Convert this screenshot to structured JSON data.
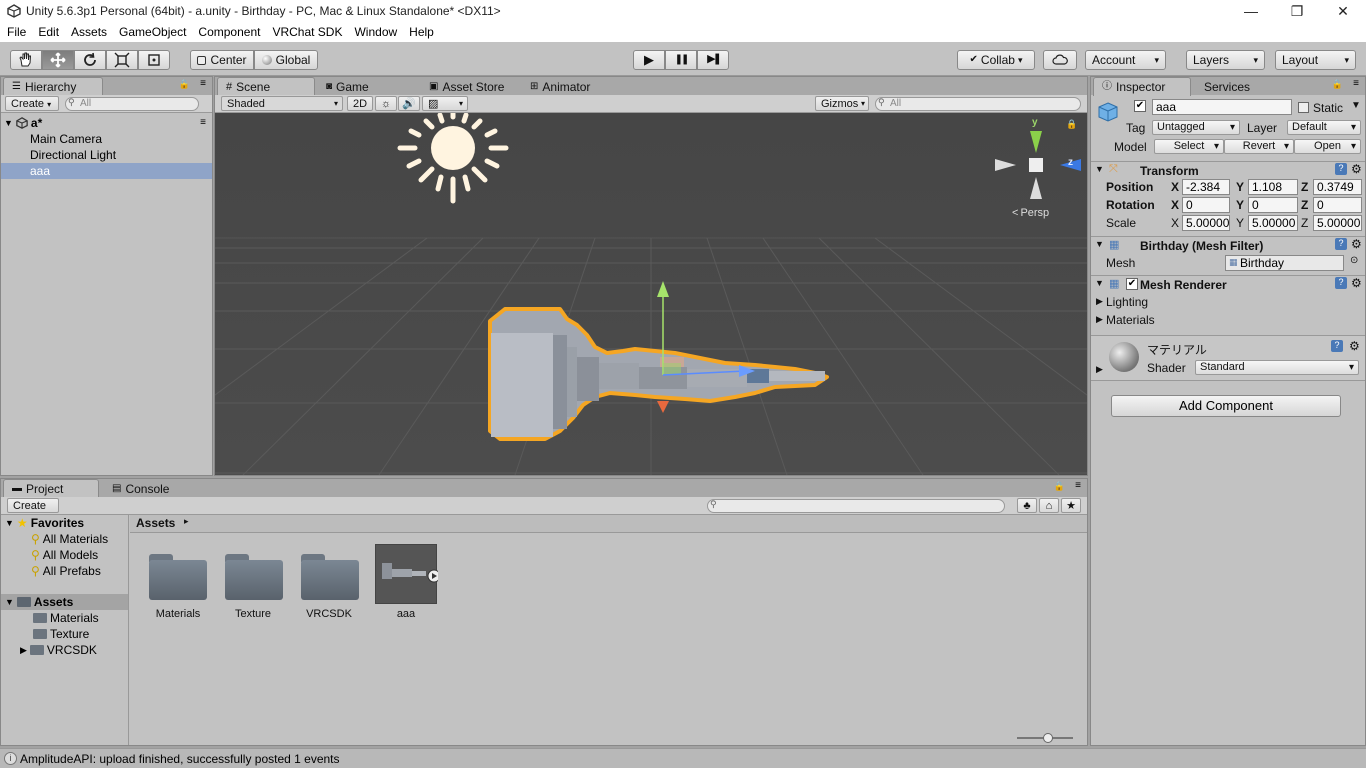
{
  "window": {
    "title": "Unity 5.6.3p1 Personal (64bit) - a.unity - Birthday - PC, Mac & Linux Standalone* <DX11>",
    "min": "—",
    "max": "❐",
    "close": "✕"
  },
  "menu": [
    "File",
    "Edit",
    "Assets",
    "GameObject",
    "Component",
    "VRChat SDK",
    "Window",
    "Help"
  ],
  "toolbar": {
    "pivot": "Center",
    "space": "Global",
    "collab": "Collab",
    "account": "Account",
    "layers": "Layers",
    "layout": "Layout",
    "play": "▶",
    "pause": "❚❚",
    "step": "▶❚"
  },
  "hierarchy": {
    "tab": "Hierarchy",
    "create": "Create",
    "search_placeholder": "All",
    "scene": "a*",
    "items": [
      "Main Camera",
      "Directional Light",
      "aaa"
    ]
  },
  "scene_view": {
    "tabs": [
      "Scene",
      "Game",
      "Asset Store",
      "Animator"
    ],
    "shading": "Shaded",
    "mode_2d": "2D",
    "gizmos": "Gizmos",
    "search_placeholder": "All",
    "axis_y": "y",
    "axis_z": "z",
    "persp": "Persp"
  },
  "inspector": {
    "tabs": [
      "Inspector",
      "Services"
    ],
    "object_name": "aaa",
    "static_label": "Static",
    "tag_label": "Tag",
    "tag_value": "Untagged",
    "layer_label": "Layer",
    "layer_value": "Default",
    "model_label": "Model",
    "model_buttons": [
      "Select",
      "Revert",
      "Open"
    ],
    "transform": {
      "title": "Transform",
      "position_label": "Position",
      "rotation_label": "Rotation",
      "scale_label": "Scale",
      "x": "X",
      "y": "Y",
      "z": "Z",
      "position": [
        "-2.384",
        "1.108",
        "0.3749"
      ],
      "rotation": [
        "0",
        "0",
        "0"
      ],
      "scale": [
        "5.00000",
        "5.00000",
        "5.00000"
      ]
    },
    "mesh_filter": {
      "title": "Birthday (Mesh Filter)",
      "mesh_label": "Mesh",
      "mesh_value": "Birthday"
    },
    "mesh_renderer": {
      "title": "Mesh Renderer",
      "lighting": "Lighting",
      "materials": "Materials"
    },
    "material": {
      "name": "マテリアル",
      "shader_label": "Shader",
      "shader_value": "Standard"
    },
    "add_component": "Add Component"
  },
  "project": {
    "tabs": [
      "Project",
      "Console"
    ],
    "create": "Create",
    "favorites_label": "Favorites",
    "favorites": [
      "All Materials",
      "All Models",
      "All Prefabs"
    ],
    "assets_label": "Assets",
    "asset_folders": [
      "Materials",
      "Texture",
      "VRCSDK"
    ],
    "breadcrumb": "Assets",
    "grid_items": [
      "Materials",
      "Texture",
      "VRCSDK",
      "aaa"
    ]
  },
  "status": {
    "message": "AmplitudeAPI: upload finished, successfully posted 1 events"
  },
  "colors": {
    "selection": "#8fa4c8",
    "outline": "#f5a623",
    "scene_bg": "#474747"
  }
}
